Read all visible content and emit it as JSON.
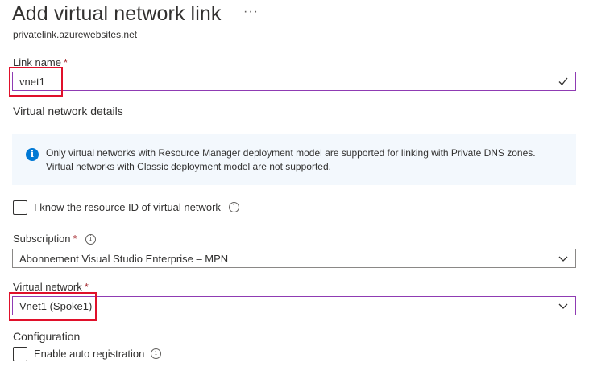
{
  "header": {
    "title": "Add virtual network link",
    "more": "···",
    "subtitle": "privatelink.azurewebsites.net"
  },
  "link_name": {
    "label": "Link name",
    "required_mark": "*",
    "value": "vnet1"
  },
  "details": {
    "heading": "Virtual network details",
    "info_line1": "Only virtual networks with Resource Manager deployment model are supported for linking with Private DNS zones.",
    "info_line2": "Virtual networks with Classic deployment model are not supported."
  },
  "resource_id": {
    "label": "I know the resource ID of virtual network",
    "checked": false
  },
  "subscription": {
    "label": "Subscription",
    "required_mark": "*",
    "value": "Abonnement Visual Studio Enterprise – MPN"
  },
  "virtual_network": {
    "label": "Virtual network",
    "required_mark": "*",
    "value": "Vnet1 (Spoke1)"
  },
  "configuration": {
    "heading": "Configuration",
    "auto_registration_label": "Enable auto registration",
    "auto_registration_checked": false
  },
  "colors": {
    "accent_purple": "#8f3bb3",
    "highlight_red": "#e0102a",
    "info_blue": "#0078d4",
    "info_bg": "#f3f8fd",
    "required_red": "#a4262c"
  },
  "icons": {
    "info": "info-circle-icon",
    "tooltip": "info-tooltip-icon",
    "dropdown": "chevron-down-icon",
    "valid": "checkmark-icon"
  }
}
